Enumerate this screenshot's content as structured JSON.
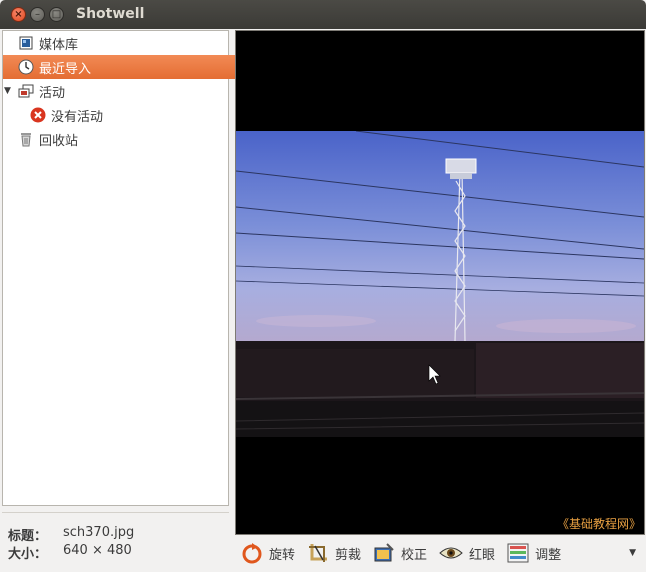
{
  "window": {
    "title": "Shotwell"
  },
  "sidebar": {
    "items": [
      {
        "label": "媒体库",
        "icon": "library-icon",
        "selected": false
      },
      {
        "label": "最近导入",
        "icon": "clock-icon",
        "selected": true
      },
      {
        "label": "活动",
        "icon": "events-icon",
        "selected": false
      },
      {
        "label": "没有活动",
        "icon": "error-icon",
        "selected": false
      },
      {
        "label": "回收站",
        "icon": "trash-icon",
        "selected": false
      }
    ]
  },
  "info": {
    "title_label": "标题：",
    "title_value": "sch370.jpg",
    "size_label": "大小：",
    "size_value": "640 × 480"
  },
  "viewer": {
    "watermark": "《基础教程网》"
  },
  "toolbar": {
    "rotate": "旋转",
    "crop": "剪裁",
    "enhance": "校正",
    "redeye": "红眼",
    "adjust": "调整"
  },
  "colors": {
    "selection": "#e8703a",
    "titlebar": "#3f3e3a"
  }
}
